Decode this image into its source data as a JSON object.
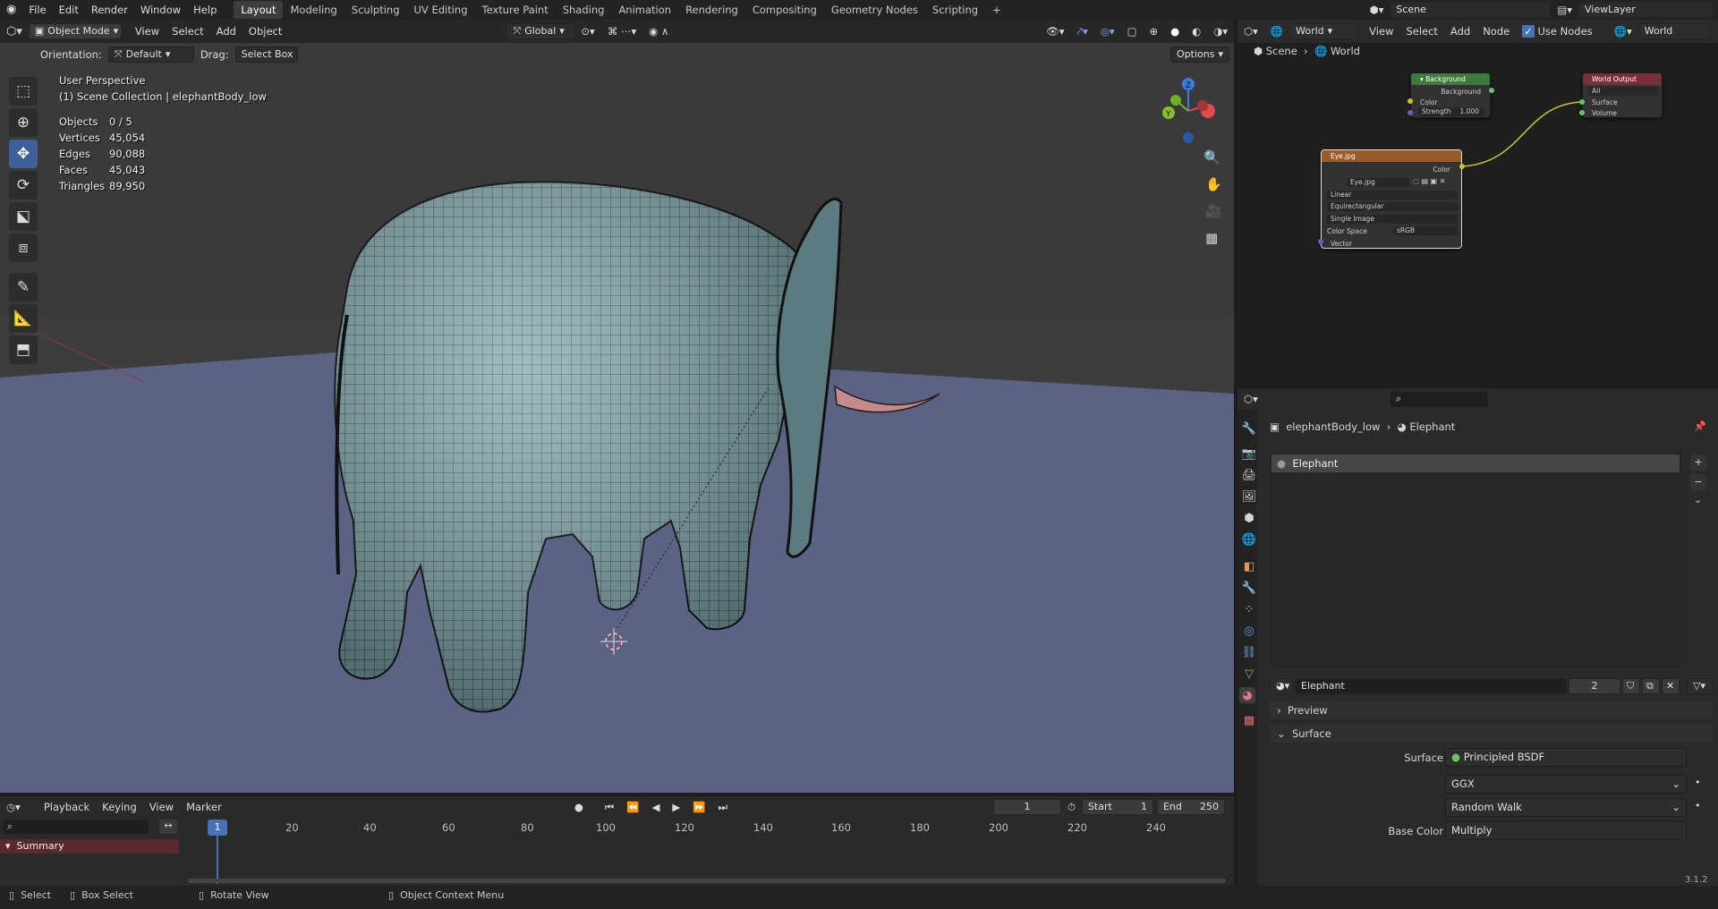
{
  "topbar": {
    "menus": [
      "File",
      "Edit",
      "Render",
      "Window",
      "Help"
    ],
    "workspaces": [
      "Layout",
      "Modeling",
      "Sculpting",
      "UV Editing",
      "Texture Paint",
      "Shading",
      "Animation",
      "Rendering",
      "Compositing",
      "Geometry Nodes",
      "Scripting"
    ],
    "add_tab": "+",
    "scene": "Scene",
    "view_layer": "ViewLayer"
  },
  "viewport_header": {
    "mode": "Object Mode",
    "menus": [
      "View",
      "Select",
      "Add",
      "Object"
    ],
    "transform": "Global"
  },
  "tool_settings": {
    "orientation_label": "Orientation:",
    "orientation": "Default",
    "drag_label": "Drag:",
    "drag": "Select Box",
    "options": "Options"
  },
  "overlay": {
    "view_name": "User Perspective",
    "collection": "(1) Scene Collection | elephantBody_low",
    "stats": [
      {
        "label": "Objects",
        "value": "0 / 5"
      },
      {
        "label": "Vertices",
        "value": "45,054"
      },
      {
        "label": "Edges",
        "value": "90,088"
      },
      {
        "label": "Faces",
        "value": "45,043"
      },
      {
        "label": "Triangles",
        "value": "89,950"
      }
    ]
  },
  "gizmo": {
    "z": "Z",
    "y": "Y"
  },
  "node_editor": {
    "world": "World",
    "menus": [
      "View",
      "Select",
      "Add",
      "Node"
    ],
    "use_nodes": "Use Nodes",
    "world_slot": "World",
    "breadcrumb": [
      "Scene",
      "World"
    ],
    "background_node": {
      "title": "Background",
      "out": "Background",
      "in_color": "Color",
      "strength_label": "Strength",
      "strength": "1.000"
    },
    "output_node": {
      "title": "World Output",
      "target": "All",
      "surface": "Surface",
      "volume": "Volume"
    },
    "image_node": {
      "title": "Eye.jpg",
      "out": "Color",
      "image": "Eye.jpg",
      "interp": "Linear",
      "proj": "Equirectangular",
      "src": "Single Image",
      "cs_label": "Color Space",
      "cs": "sRGB",
      "vector": "Vector"
    }
  },
  "properties": {
    "breadcrumb_obj": "elephantBody_low",
    "breadcrumb_mat": "Elephant",
    "slot": "Elephant",
    "material_name": "Elephant",
    "users": "2",
    "preview": "Preview",
    "surface_panel": "Surface",
    "surface_label": "Surface",
    "surface_value": "Principled BSDF",
    "distribution": "GGX",
    "subsurface": "Random Walk",
    "base_color": "Base Color",
    "base_color_value": "Multiply"
  },
  "timeline": {
    "menus": [
      "Playback",
      "Keying",
      "View",
      "Marker"
    ],
    "current_frame": "1",
    "start_label": "Start",
    "start": "1",
    "end_label": "End",
    "end": "250",
    "ruler": [
      "20",
      "40",
      "60",
      "80",
      "100",
      "120",
      "140",
      "160",
      "180",
      "200",
      "220",
      "240"
    ],
    "summary": "Summary",
    "frame_badge": "1"
  },
  "statusbar": {
    "select": "Select",
    "box_select": "Box Select",
    "rotate": "Rotate View",
    "context": "Object Context Menu",
    "version": "3.1.2"
  }
}
